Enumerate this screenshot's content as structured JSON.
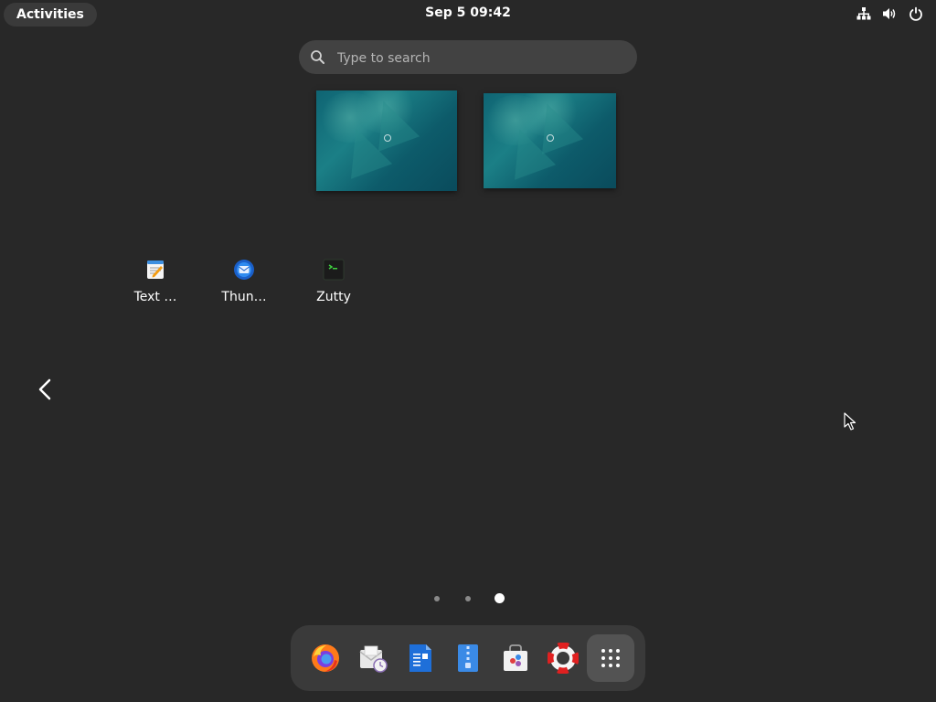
{
  "topbar": {
    "activities_label": "Activities",
    "clock": "Sep 5  09:42",
    "tray_icons": [
      "network-icon",
      "volume-icon",
      "power-icon"
    ]
  },
  "search": {
    "placeholder": "Type to search"
  },
  "workspaces": [
    {
      "name": "workspace-1"
    },
    {
      "name": "workspace-2"
    }
  ],
  "app_grid": {
    "apps": [
      {
        "label": "Text …",
        "icon": "text-editor-icon"
      },
      {
        "label": "Thun…",
        "icon": "thunderbird-icon"
      },
      {
        "label": "Zutty",
        "icon": "terminal-icon"
      }
    ]
  },
  "pagination": {
    "page_count": 3,
    "current_page": 3
  },
  "dock": {
    "items": [
      {
        "name": "firefox",
        "icon": "firefox-icon"
      },
      {
        "name": "evolution",
        "icon": "mail-clock-icon"
      },
      {
        "name": "libreoffice-writer",
        "icon": "writer-document-icon"
      },
      {
        "name": "file-roller",
        "icon": "archive-icon"
      },
      {
        "name": "software",
        "icon": "software-bag-icon"
      },
      {
        "name": "help",
        "icon": "lifebuoy-icon"
      },
      {
        "name": "show-apps",
        "icon": "app-grid-icon"
      }
    ]
  },
  "colors": {
    "background": "#282828",
    "panel": "#3a3a3a",
    "search_bg": "#424242",
    "dot_active": "#ffffff",
    "dot_inactive": "#8a8a8a"
  }
}
